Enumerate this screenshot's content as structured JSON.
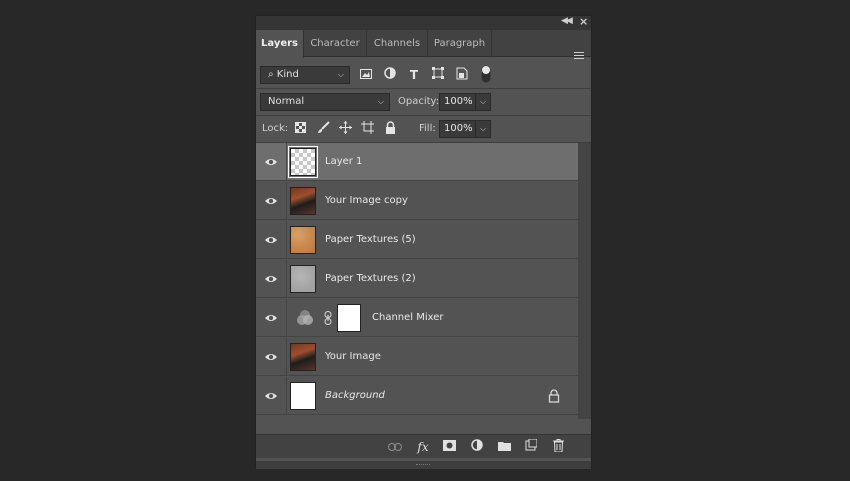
{
  "tabs": [
    "Layers",
    "Character",
    "Channels",
    "Paragraph"
  ],
  "filter": {
    "label": "Kind"
  },
  "blend": {
    "mode": "Normal",
    "opacity_label": "Opacity:",
    "opacity": "100%"
  },
  "lock": {
    "label": "Lock:",
    "fill_label": "Fill:",
    "fill": "100%"
  },
  "layers": [
    {
      "name": "Layer 1",
      "thumb": "transparent",
      "selected": true
    },
    {
      "name": "Your Image copy",
      "thumb": "photo"
    },
    {
      "name": "Paper Textures (5)",
      "thumb": "orange-texture"
    },
    {
      "name": "Paper Textures (2)",
      "thumb": "grey-texture"
    },
    {
      "name": "Channel Mixer",
      "thumb": "adjustment-with-mask"
    },
    {
      "name": "Your Image",
      "thumb": "photo"
    },
    {
      "name": "Background",
      "thumb": "white",
      "locked": true,
      "italic": true
    }
  ],
  "bottom_icons": [
    "link-icon",
    "fx-icon",
    "mask-icon",
    "adjustment-icon",
    "folder-icon",
    "new-layer-icon",
    "trash-icon"
  ],
  "colors": {
    "panel": "#535353",
    "selected": "#6e6e6e",
    "background": "#282828"
  }
}
